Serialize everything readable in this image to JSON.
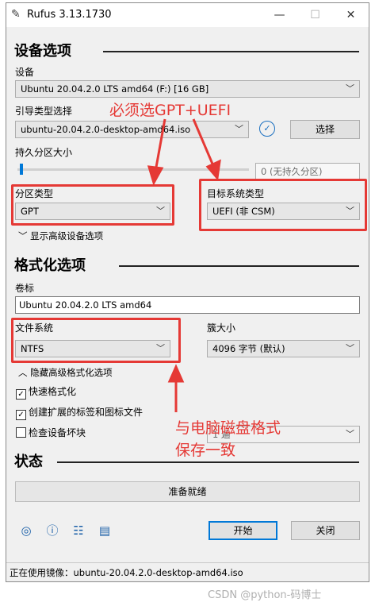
{
  "window": {
    "title": "Rufus 3.13.1730",
    "minimize": "—",
    "maximize": "☐",
    "close": "✕"
  },
  "drive_section": {
    "heading": "设备选项",
    "device_label": "设备",
    "device_value": "Ubuntu 20.04.2.0 LTS amd64 (F:) [16 GB]",
    "boot_label": "引导类型选择",
    "boot_value": "ubuntu-20.04.2.0-desktop-amd64.iso",
    "select_button": "选择",
    "persistent_label": "持久分区大小",
    "persistent_value": "0 (无持久分区)",
    "partition_label": "分区类型",
    "partition_value": "GPT",
    "target_label": "目标系统类型",
    "target_value": "UEFI (非 CSM)",
    "advanced_toggle": "显示高级设备选项"
  },
  "format_section": {
    "heading": "格式化选项",
    "volume_label": "卷标",
    "volume_value": "Ubuntu 20.04.2.0 LTS amd64",
    "fs_label": "文件系统",
    "fs_value": "NTFS",
    "cluster_label": "簇大小",
    "cluster_value": "4096 字节 (默认)",
    "advanced_toggle": "隐藏高级格式化选项",
    "quick_format": "快速格式化",
    "extended_label": "创建扩展的标签和图标文件",
    "bad_blocks": "检查设备坏块",
    "bad_blocks_passes": "1 遍"
  },
  "status_section": {
    "heading": "状态",
    "progress_text": "准备就绪",
    "progress_fraction": 0
  },
  "buttons": {
    "start": "开始",
    "close": "关闭"
  },
  "status_bar": "正在使用镜像：ubuntu-20.04.2.0-desktop-amd64.iso",
  "annotations": {
    "note_top": "必须选GPT+UEFI",
    "note_bottom_line1": "与电脑磁盘格式",
    "note_bottom_line2": "保存一致",
    "color": "#e53935"
  },
  "watermark": "CSDN @python-码博士",
  "colors": {
    "window_bg": "#f0f0f0",
    "accent": "#0078d7",
    "annotation": "#e53935"
  },
  "icons": [
    "globe-icon",
    "info-icon",
    "settings-icon",
    "log-icon"
  ]
}
